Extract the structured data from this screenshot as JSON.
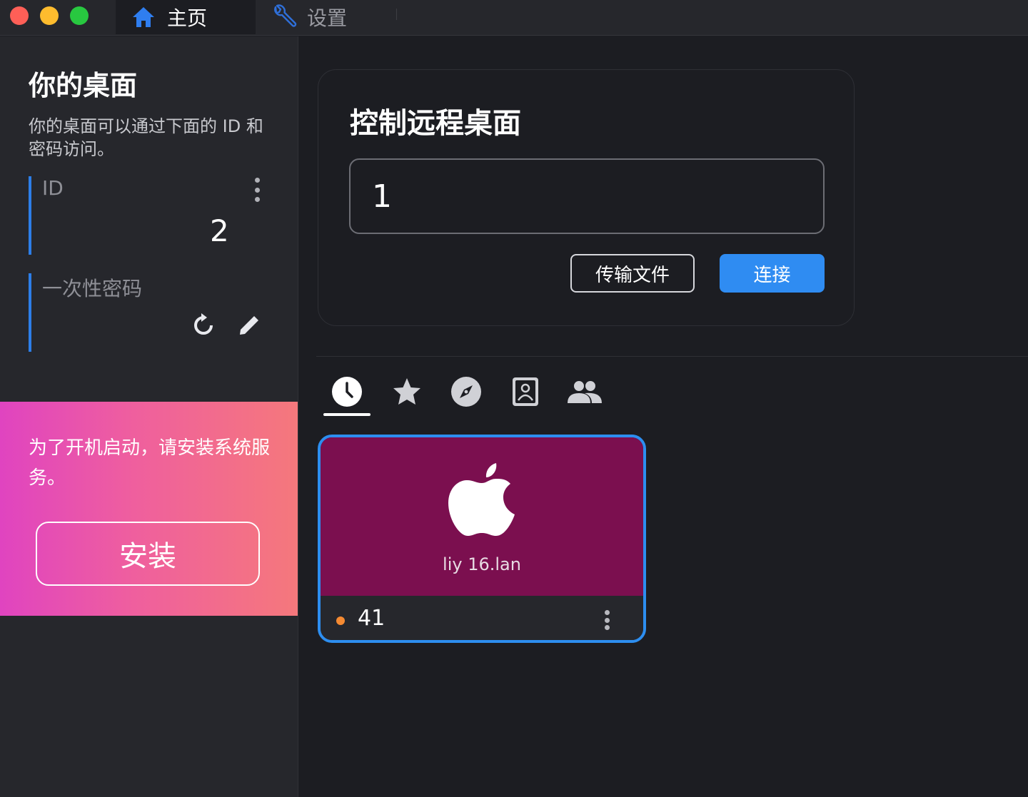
{
  "titlebar": {
    "tabs": [
      {
        "label": "主页",
        "icon": "home-icon",
        "active": true
      },
      {
        "label": "设置",
        "icon": "wrench-icon",
        "active": false
      }
    ]
  },
  "sidebar": {
    "title": "你的桌面",
    "description": "你的桌面可以通过下面的 ID 和密码访问。",
    "id_label": "ID",
    "id_value": "2",
    "password_label": "一次性密码",
    "password_value": ""
  },
  "install_banner": {
    "text": "为了开机启动，请安装系统服务。",
    "button_label": "安装"
  },
  "remote": {
    "title": "控制远程桌面",
    "input_value": "1",
    "transfer_label": "传输文件",
    "connect_label": "连接"
  },
  "peer_tabs": [
    {
      "icon": "history-clock-icon",
      "active": true
    },
    {
      "icon": "star-icon",
      "active": false
    },
    {
      "icon": "compass-icon",
      "active": false
    },
    {
      "icon": "address-book-icon",
      "active": false
    },
    {
      "icon": "group-icon",
      "active": false
    }
  ],
  "peer_card": {
    "hostname": "liy                    16.lan",
    "id": "                41",
    "platform_icon": "apple-icon",
    "status_color": "#f58a32"
  },
  "colors": {
    "accent": "#2f8cf2",
    "peer_card_bg": "#7b0f4f"
  }
}
